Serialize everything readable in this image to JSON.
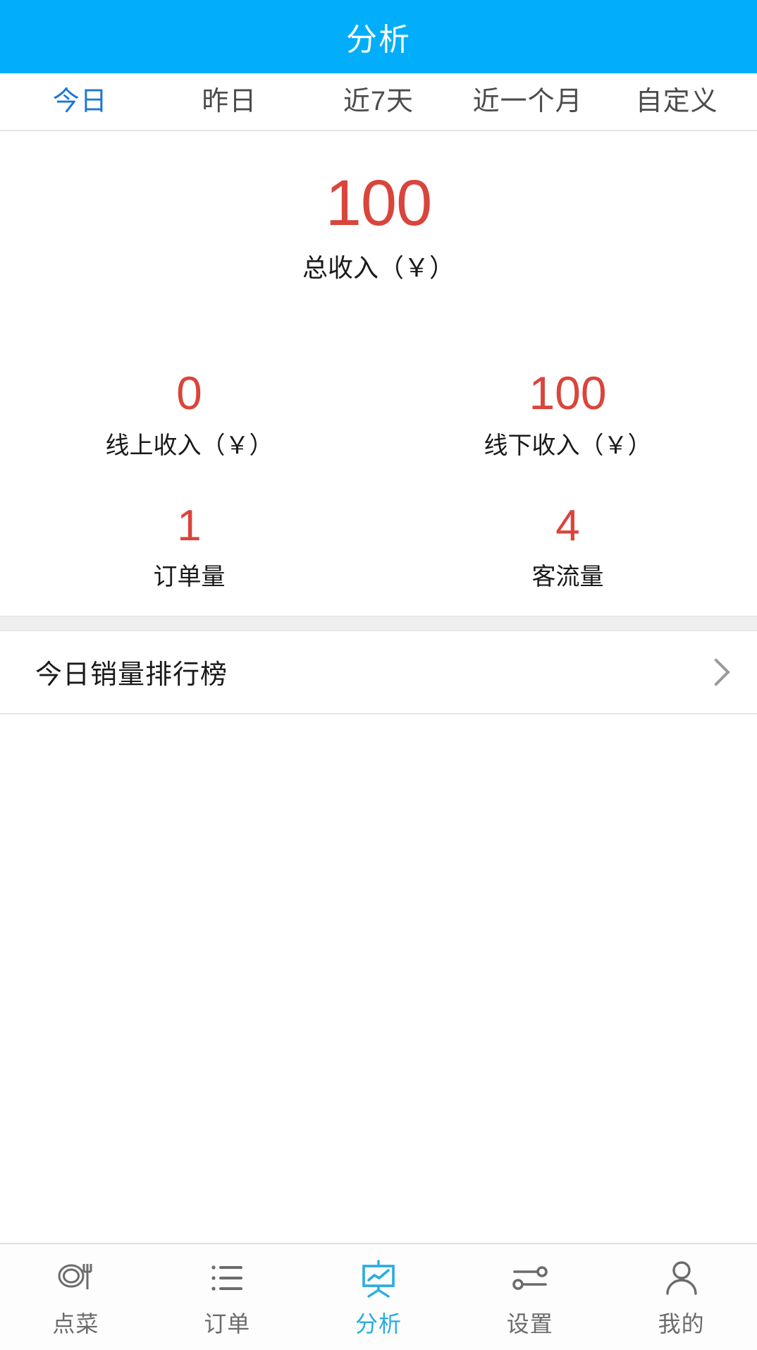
{
  "header": {
    "title": "分析",
    "background_color": "#02AEFA",
    "title_color": "#ffffff"
  },
  "period_tabs": {
    "active_index": 0,
    "active_color": "#1a78d6",
    "inactive_color": "#4b4b4b",
    "items": [
      {
        "label": "今日"
      },
      {
        "label": "昨日"
      },
      {
        "label": "近7天"
      },
      {
        "label": "近一个月"
      },
      {
        "label": "自定义"
      }
    ]
  },
  "stats": {
    "accent_color": "#d9453c",
    "total": {
      "value": "100",
      "label": "总收入（￥）"
    },
    "income_row": [
      {
        "value": "0",
        "label": "线上收入（￥）"
      },
      {
        "value": "100",
        "label": "线下收入（￥）"
      }
    ],
    "count_row": [
      {
        "value": "1",
        "label": "订单量"
      },
      {
        "value": "4",
        "label": "客流量"
      }
    ]
  },
  "ranking_row": {
    "label": "今日销量排行榜",
    "chevron_icon": "chevron-right-icon"
  },
  "bottom_nav": {
    "active_index": 2,
    "active_color": "#29ABE2",
    "inactive_color": "#6b6b6b",
    "items": [
      {
        "label": "点菜",
        "icon": "plate-fork-icon"
      },
      {
        "label": "订单",
        "icon": "list-icon"
      },
      {
        "label": "分析",
        "icon": "chart-board-icon"
      },
      {
        "label": "设置",
        "icon": "sliders-icon"
      },
      {
        "label": "我的",
        "icon": "user-icon"
      }
    ]
  }
}
